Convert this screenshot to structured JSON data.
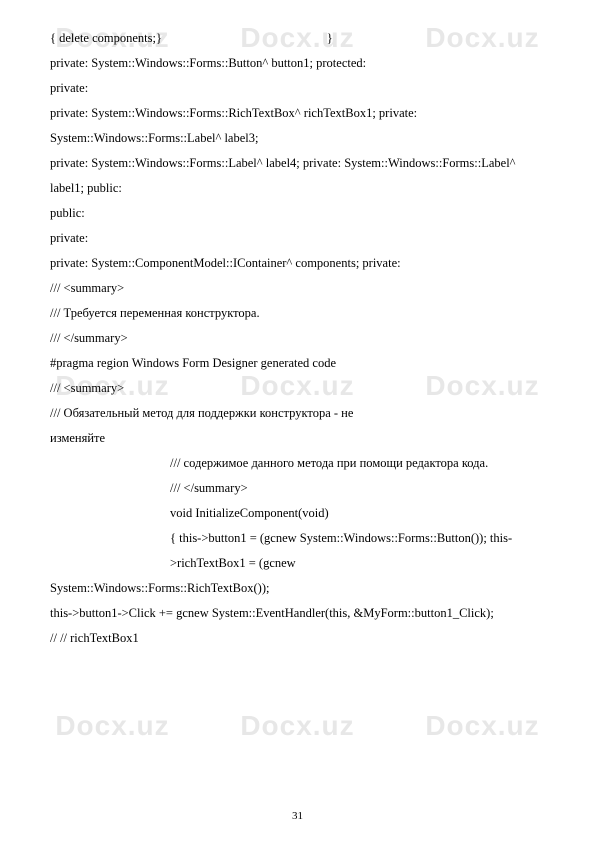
{
  "watermark": "Docx.uz",
  "page_number": "31",
  "lines": [
    {
      "type": "spread",
      "left": "{   delete components;}",
      "right": "}"
    },
    {
      "text": "private: System::Windows::Forms::Button^ button1; protected:"
    },
    {
      "text": "private:"
    },
    {
      "text": "private: System::Windows::Forms::RichTextBox^  richTextBox1; private:"
    },
    {
      "text": "System::Windows::Forms::Label^  label3;"
    },
    {
      "text": "private:   System::Windows::Forms::Label^   label4;   private:   System::Windows::Forms::Label^"
    },
    {
      "text": "label1; public:"
    },
    {
      "text": "public:"
    },
    {
      "text": "private:"
    },
    {
      "text": "private: System::ComponentModel::IContainer^ components; private:"
    },
    {
      "text": "/// <summary>"
    },
    {
      "text": "/// Требуется переменная конструктора."
    },
    {
      "text": "/// </summary>"
    },
    {
      "text": "#pragma region Windows Form Designer generated code"
    },
    {
      "text": "/// <summary>"
    },
    {
      "text": "/// Обязательный метод для поддержки конструктора - не"
    },
    {
      "text": "изменяйте"
    },
    {
      "text": "/// содержимое данного метода при помощи редактора кода.",
      "indent": true
    },
    {
      "text": "/// </summary>",
      "indent": true
    },
    {
      "text": "void InitializeComponent(void)",
      "indent": true
    },
    {
      "text": "{ this->button1 = (gcnew System::Windows::Forms::Button()); this-",
      "indent": true
    },
    {
      "text": ">richTextBox1 = (gcnew",
      "indent": true
    },
    {
      "text": "System::Windows::Forms::RichTextBox());"
    },
    {
      "text": "this->button1->Click += gcnew System::EventHandler(this, &MyForm::button1_Click);"
    },
    {
      "text": "// // richTextBox1"
    }
  ]
}
